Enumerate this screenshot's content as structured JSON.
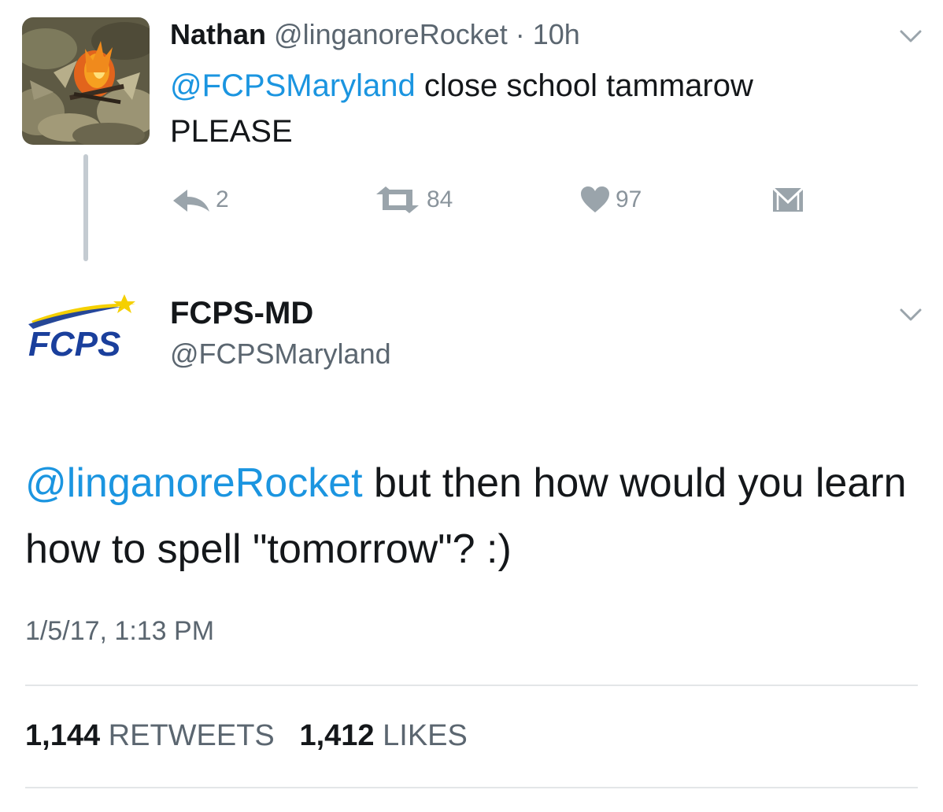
{
  "parent_tweet": {
    "author_name": "Nathan",
    "author_handle": "@linganoreRocket",
    "separator": "·",
    "time_ago": "10h",
    "mention": "@FCPSMaryland",
    "text_line1_rest": "close school tammarow",
    "text_line2": "PLEASE",
    "reply_count": "2",
    "retweet_count": "84",
    "like_count": "97",
    "avatar_icon": "campfire-photo-avatar",
    "menu_icon": "chevron-down-icon"
  },
  "main_tweet": {
    "author_name": "FCPS-MD",
    "author_handle": "@FCPSMaryland",
    "logo_text": "FCPS",
    "mention": "@linganoreRocket",
    "text_rest": " but then how would you learn how to spell \"tomorrow\"? :)",
    "timestamp": "1/5/17, 1:13 PM",
    "retweets_count": "1,144",
    "retweets_label": "RETWEETS",
    "likes_count": "1,412",
    "likes_label": "LIKES",
    "menu_icon": "chevron-down-icon"
  },
  "colors": {
    "link_blue": "#1b95e0",
    "secondary_text": "#5b6670",
    "icon_grey": "#8a949c",
    "logo_blue": "#1a3f9c",
    "logo_star": "#f5d000"
  }
}
